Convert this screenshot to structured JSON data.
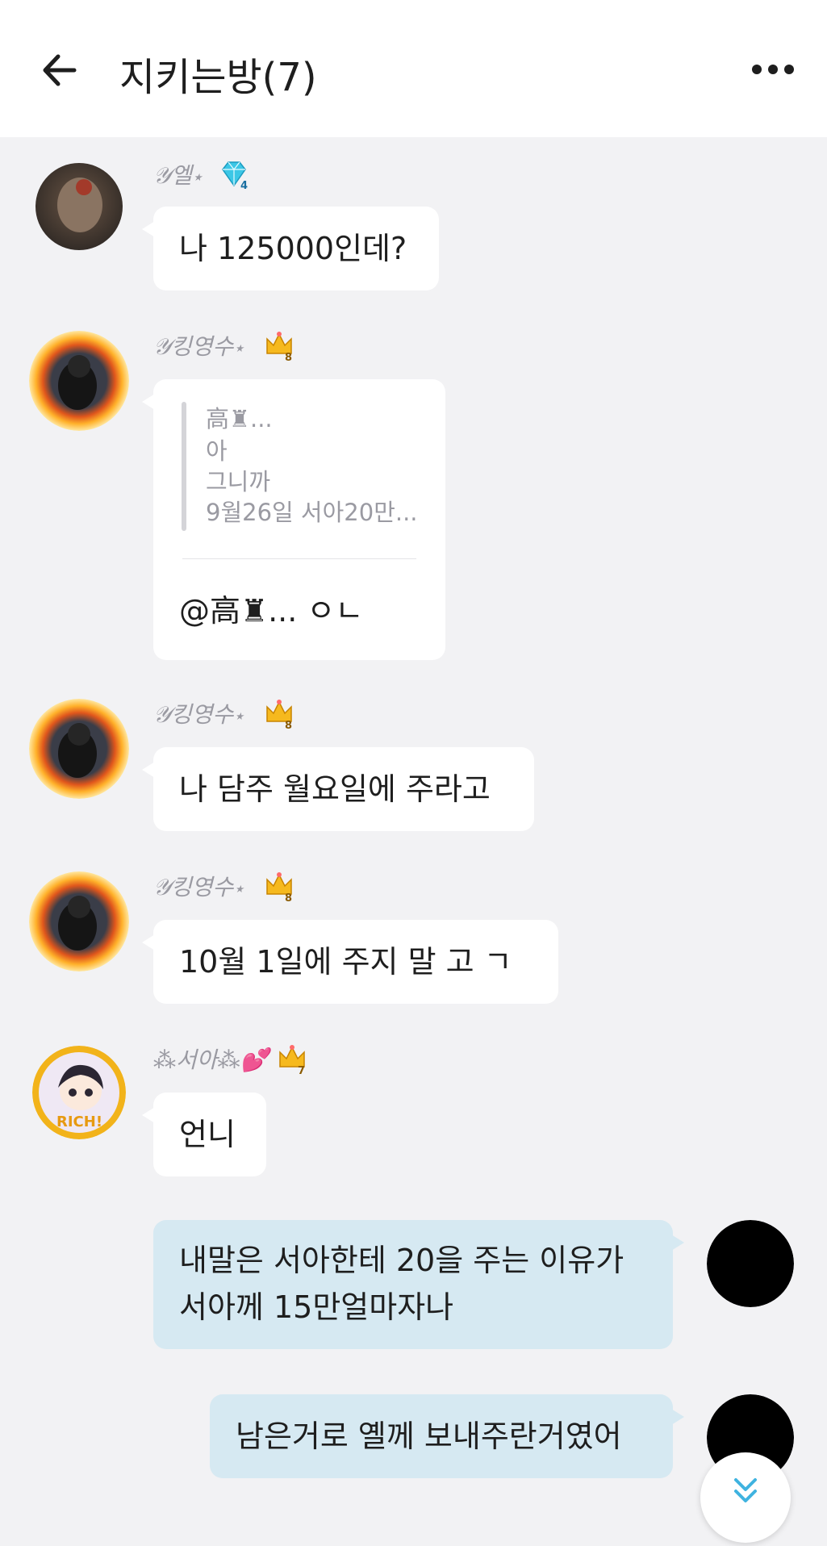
{
  "header": {
    "title": "지키는방(7)",
    "back_icon": "arrow-left-icon",
    "more_icon": "ellipsis-icon"
  },
  "colors": {
    "background": "#f2f2f4",
    "bubble_other": "#ffffff",
    "bubble_mine": "#d6e9f2",
    "sender_name": "#9a9aa2"
  },
  "messages": [
    {
      "sender": "𝒴엘⋆",
      "badge_icon": "diamond-level-icon",
      "badge_level": "4",
      "text": "나 125000인데?"
    },
    {
      "sender": "𝒴킹영수⋆",
      "badge_icon": "crown-level-icon",
      "badge_level": "8",
      "quote": {
        "author": "高♜...",
        "lines": [
          "아",
          "그니까",
          "9월26일 서아20만..."
        ]
      },
      "text": "@高♜... ㅇㄴ"
    },
    {
      "sender": "𝒴킹영수⋆",
      "badge_icon": "crown-level-icon",
      "badge_level": "8",
      "text": "나 담주 월요일에 주라고"
    },
    {
      "sender": "𝒴킹영수⋆",
      "badge_icon": "crown-level-icon",
      "badge_level": "8",
      "text": "10월 1일에 주지 말 고  ㄱ"
    },
    {
      "sender": "⁂서아⁂💕",
      "badge_icon": "crown-level-icon",
      "badge_level": "7",
      "avatar_text": "RICH!",
      "text": "언니"
    },
    {
      "mine": true,
      "lines": [
        "내말은 서아한테 20을 주는 이유가",
        "서아께 15만얼마자나"
      ]
    },
    {
      "mine": true,
      "text": "남은거로 옐께 보내주란거였어"
    }
  ],
  "scroll_button": {
    "icon": "double-chevron-down-icon"
  }
}
